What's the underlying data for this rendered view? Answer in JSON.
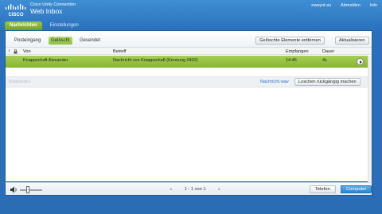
{
  "header": {
    "brand_line1": "Cisco Unity Connection",
    "brand_line2": "Web Inbox",
    "user": "ewaynt.su",
    "logout": "Abmelden",
    "info": "Info"
  },
  "tabs": [
    {
      "label": "Nachrichten",
      "active": true
    },
    {
      "label": "Einstellungen",
      "active": false
    }
  ],
  "subtabs": [
    {
      "label": "Posteingang",
      "selected": false
    },
    {
      "label": "Gelöscht",
      "selected": true
    },
    {
      "label": "Gesendet",
      "selected": false
    }
  ],
  "toolbar": {
    "delete_label": "Gelöschte Elemente entfernen",
    "refresh_label": "Aktualisieren"
  },
  "columns": {
    "flag": "!",
    "lock": "lock-icon",
    "from": "Von",
    "subject": "Betreff",
    "received": "Empfangen",
    "duration": "Dauer"
  },
  "message": {
    "from": "Knappschaft Alexander",
    "subject": "Nachricht von Knappschaft (Kennung 0402)",
    "received": "14:46",
    "duration": "4s"
  },
  "action_bar": {
    "edit_label": "Bearbeiten",
    "file_label": "Nachricht.wav",
    "undo_label": "Loschen rückgängig machen"
  },
  "footer": {
    "page_text": "1 - 1 von 1",
    "phone_label": "Telefon",
    "computer_label": "Computer",
    "volume_level": 0.35
  },
  "colors": {
    "accent_green": "#8fc03f",
    "brand_blue": "#2b6db5",
    "link_blue": "#1e73be"
  }
}
